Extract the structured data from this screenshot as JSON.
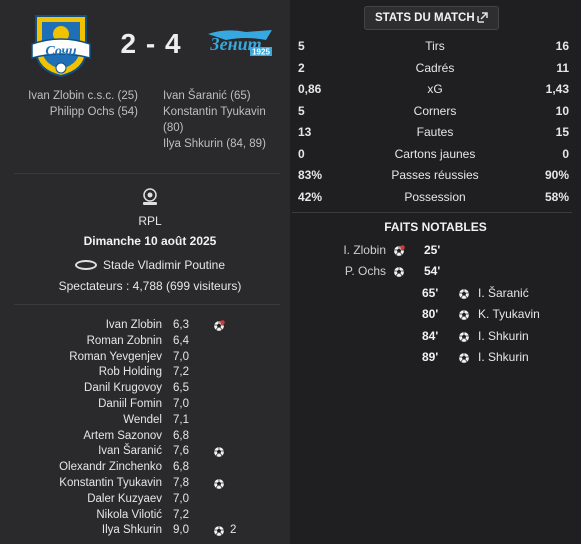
{
  "match": {
    "home_team_logo": "sochi-crest",
    "away_team_logo": "zenit-crest",
    "away_logo_text": "Зенит",
    "away_logo_year": "1925",
    "score": "2 - 4",
    "home_scorers": [
      "Ivan Zlobin c.s.c. (25)",
      "Philipp Ochs (54)"
    ],
    "away_scorers": [
      "Ivan Šaranić (65)",
      "Konstantin Tyukavin",
      "(80)",
      "Ilya Shkurin (84, 89)"
    ],
    "competition_icon": "rpl-icon",
    "competition": "RPL",
    "date": "Dimanche 10 août 2025",
    "stadium_icon": "stadium-icon",
    "stadium": "Stade Vladimir Poutine",
    "attendance": "Spectateurs : 4,788 (699 visiteurs)"
  },
  "ratings": [
    {
      "name": "Ivan Zlobin",
      "rating": "6,3",
      "icon": "own-goal-icon",
      "count": ""
    },
    {
      "name": "Roman Zobnin",
      "rating": "6,4",
      "icon": "",
      "count": ""
    },
    {
      "name": "Roman Yevgenjev",
      "rating": "7,0",
      "icon": "",
      "count": ""
    },
    {
      "name": "Rob Holding",
      "rating": "7,2",
      "icon": "",
      "count": ""
    },
    {
      "name": "Danil Krugovoy",
      "rating": "6,5",
      "icon": "",
      "count": ""
    },
    {
      "name": "Daniil Fomin",
      "rating": "7,0",
      "icon": "",
      "count": ""
    },
    {
      "name": "Wendel",
      "rating": "7,1",
      "icon": "",
      "count": ""
    },
    {
      "name": "Artem Sazonov",
      "rating": "6,8",
      "icon": "",
      "count": ""
    },
    {
      "name": "Ivan Šaranić",
      "rating": "7,6",
      "icon": "goal-icon",
      "count": ""
    },
    {
      "name": "Olexandr Zinchenko",
      "rating": "6,8",
      "icon": "",
      "count": ""
    },
    {
      "name": "Konstantin Tyukavin",
      "rating": "7,8",
      "icon": "goal-icon",
      "count": ""
    },
    {
      "name": "Daler Kuzyaev",
      "rating": "7,0",
      "icon": "",
      "count": ""
    },
    {
      "name": "Nikola Vilotić",
      "rating": "7,2",
      "icon": "",
      "count": ""
    },
    {
      "name": "Ilya Shkurin",
      "rating": "9,0",
      "icon": "goal-icon",
      "count": "2"
    }
  ],
  "stats_header": {
    "label": "STATS DU MATCH",
    "icon": "expand-icon"
  },
  "stats": [
    {
      "home": "5",
      "label": "Tirs",
      "away": "16"
    },
    {
      "home": "2",
      "label": "Cadrés",
      "away": "11"
    },
    {
      "home": "0,86",
      "label": "xG",
      "away": "1,43"
    },
    {
      "home": "5",
      "label": "Corners",
      "away": "10"
    },
    {
      "home": "13",
      "label": "Fautes",
      "away": "15"
    },
    {
      "home": "0",
      "label": "Cartons jaunes",
      "away": "0"
    },
    {
      "home": "83%",
      "label": "Passes réussies",
      "away": "90%"
    },
    {
      "home": "42%",
      "label": "Possession",
      "away": "58%"
    }
  ],
  "notable_title": "FAITS NOTABLES",
  "events": [
    {
      "side": "home",
      "player": "I. Zlobin",
      "minute": "25'",
      "icon": "own-goal-icon"
    },
    {
      "side": "home",
      "player": "P. Ochs",
      "minute": "54'",
      "icon": "goal-icon"
    },
    {
      "side": "away",
      "player": "I. Šaranić",
      "minute": "65'",
      "icon": "goal-icon"
    },
    {
      "side": "away",
      "player": "K. Tyukavin",
      "minute": "80'",
      "icon": "goal-icon"
    },
    {
      "side": "away",
      "player": "I. Shkurin",
      "minute": "84'",
      "icon": "goal-icon"
    },
    {
      "side": "away",
      "player": "I. Shkurin",
      "minute": "89'",
      "icon": "goal-icon"
    }
  ],
  "colors": {
    "panel_left": "#2a2a2c",
    "panel_right": "#1f1f21",
    "sochi_blue": "#1e6fb5",
    "sochi_yellow": "#f2c200",
    "zenit_blue": "#37a8e0",
    "own_goal_red": "#d03a3a"
  }
}
